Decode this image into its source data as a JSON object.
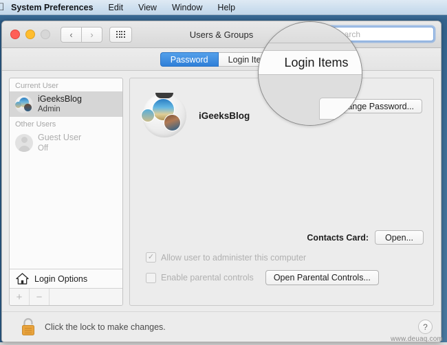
{
  "menubar": {
    "apple_icon": "apple-logo",
    "items": [
      {
        "label": "System Preferences",
        "bold": true
      },
      {
        "label": "Edit"
      },
      {
        "label": "View"
      },
      {
        "label": "Window"
      },
      {
        "label": "Help"
      }
    ]
  },
  "window": {
    "title": "Users & Groups",
    "traffic_lights": {
      "close": "close-button",
      "minimize": "minimize-button",
      "zoom": "zoom-button"
    },
    "nav": {
      "back": "‹",
      "forward": "›",
      "grid": "show-all-grid-icon"
    },
    "search": {
      "placeholder": "Search",
      "value": "",
      "focused": true
    }
  },
  "tabs": [
    {
      "label": "Password",
      "selected": true
    },
    {
      "label": "Login Items",
      "selected": false
    }
  ],
  "sidebar": {
    "groups": [
      {
        "header": "Current User",
        "users": [
          {
            "name": "iGeeksBlog",
            "role": "Admin",
            "selected": true,
            "disabled": false,
            "avatar": "user-photo-avatar"
          }
        ]
      },
      {
        "header": "Other Users",
        "users": [
          {
            "name": "Guest User",
            "role": "Off",
            "selected": false,
            "disabled": true,
            "avatar": "guest-silhouette-avatar"
          }
        ]
      }
    ],
    "login_options": {
      "label": "Login Options",
      "icon": "home-icon"
    },
    "footer": {
      "add": "+",
      "remove": "−"
    }
  },
  "content": {
    "account_name": "iGeeksBlog",
    "avatar_icon": "account-picture",
    "change_password_label": "Change Password...",
    "change_password_visible_text": "ge Password...",
    "contacts_card_label": "Contacts Card:",
    "contacts_card_button": "Open...",
    "admin_checkbox": {
      "label": "Allow user to administer this computer",
      "checked": true,
      "enabled": false,
      "mark": "✓"
    },
    "parental_checkbox": {
      "label": "Enable parental controls",
      "checked": false,
      "enabled": false,
      "mark": ""
    },
    "parental_button": "Open Parental Controls..."
  },
  "footer": {
    "lock_icon": "unlocked-padlock-icon",
    "lock_text": "Click the lock to make changes.",
    "help_label": "?"
  },
  "magnifier": {
    "magnified_label": "Login Items"
  },
  "watermark": "www.deuaq.com",
  "colors": {
    "accent_blue": "#2f7fd8",
    "menubar_blue": "#cfe0ef",
    "desktop_blue": "#2b5a86",
    "lock_gold": "#e8a33d",
    "window_gray": "#ececec"
  }
}
